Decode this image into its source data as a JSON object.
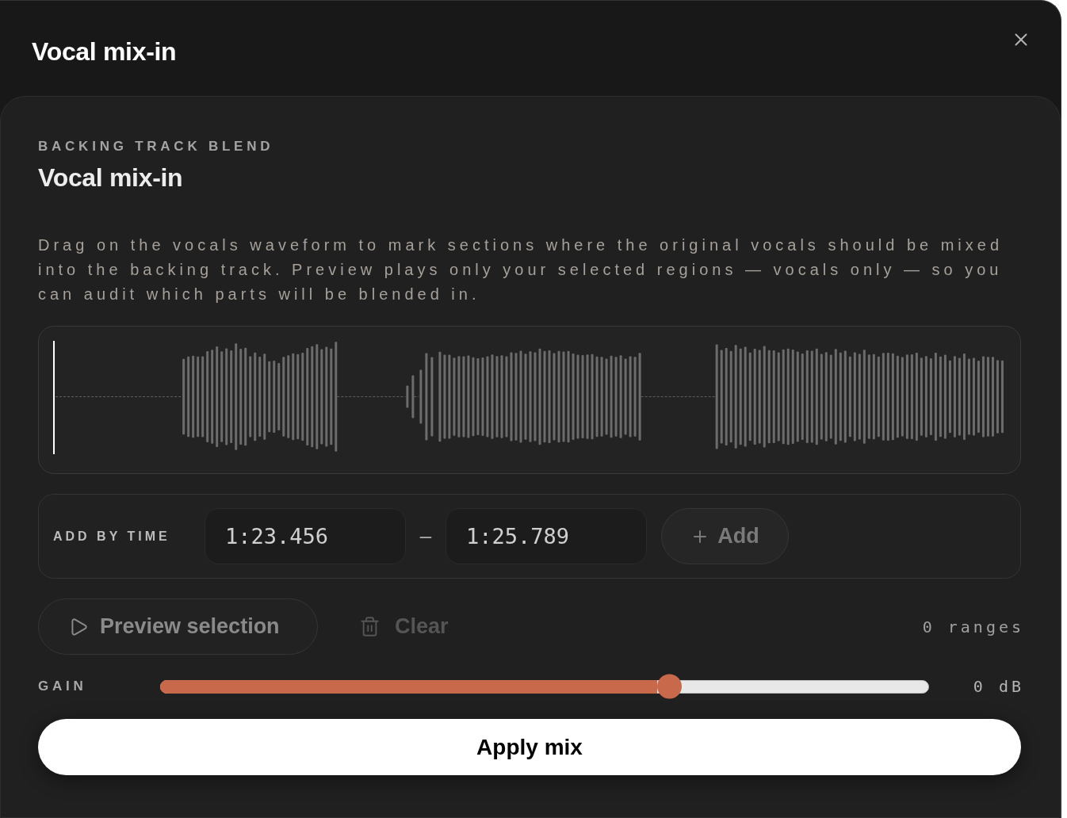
{
  "dialog": {
    "title": "Vocal mix-in"
  },
  "card": {
    "eyebrow": "BACKING TRACK BLEND",
    "title": "Vocal mix-in",
    "description": "Drag on the vocals waveform to mark sections where the original vocals should be mixed into the backing track. Preview plays only your selected regions — vocals only — so you can audit which parts will be blended in."
  },
  "add_by_time": {
    "label": "ADD BY TIME",
    "start": {
      "value": "1:23.456"
    },
    "separator": "–",
    "end": {
      "value": "1:25.789"
    },
    "add_button": {
      "label": "Add",
      "disabled": false
    }
  },
  "actions": {
    "preview_button": {
      "label": "Preview selection",
      "disabled": true
    },
    "clear_button": {
      "label": "Clear",
      "disabled": true
    },
    "range_count": "0 ranges"
  },
  "gain": {
    "label": "GAIN",
    "level": 0.662,
    "reading": "0 dB"
  },
  "apply_button": {
    "label": "Apply mix"
  }
}
